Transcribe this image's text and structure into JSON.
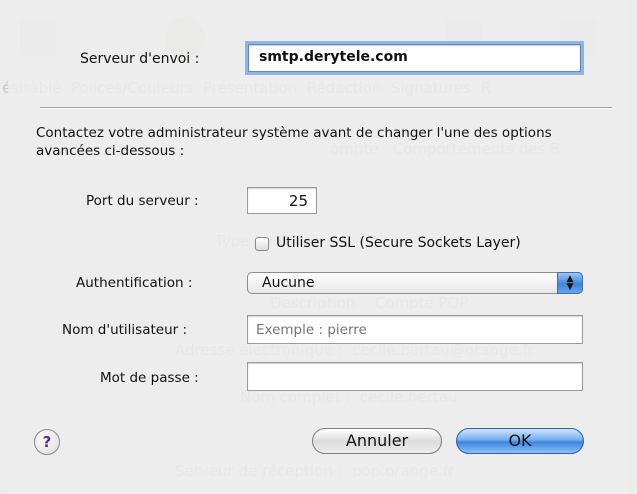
{
  "window_title": "",
  "dialog": {
    "smtp_server_label": "Serveur d'envoi :",
    "smtp_server_value": "smtp.derytele.com",
    "advanced_notice": "Contactez votre administrateur système avant de changer l'une des options avancées ci-dessous :",
    "port_label": "Port du serveur :",
    "port_value": "25",
    "ssl_label": "Utiliser SSL (Secure Sockets Layer)",
    "ssl_checked": false,
    "auth_label": "Authentification :",
    "auth_value": "Aucune",
    "username_label": "Nom d'utilisateur :",
    "username_placeholder": "Exemple : pierre",
    "password_label": "Mot de passe :",
    "help_label": "?",
    "cancel_label": "Annuler",
    "ok_label": "OK"
  }
}
